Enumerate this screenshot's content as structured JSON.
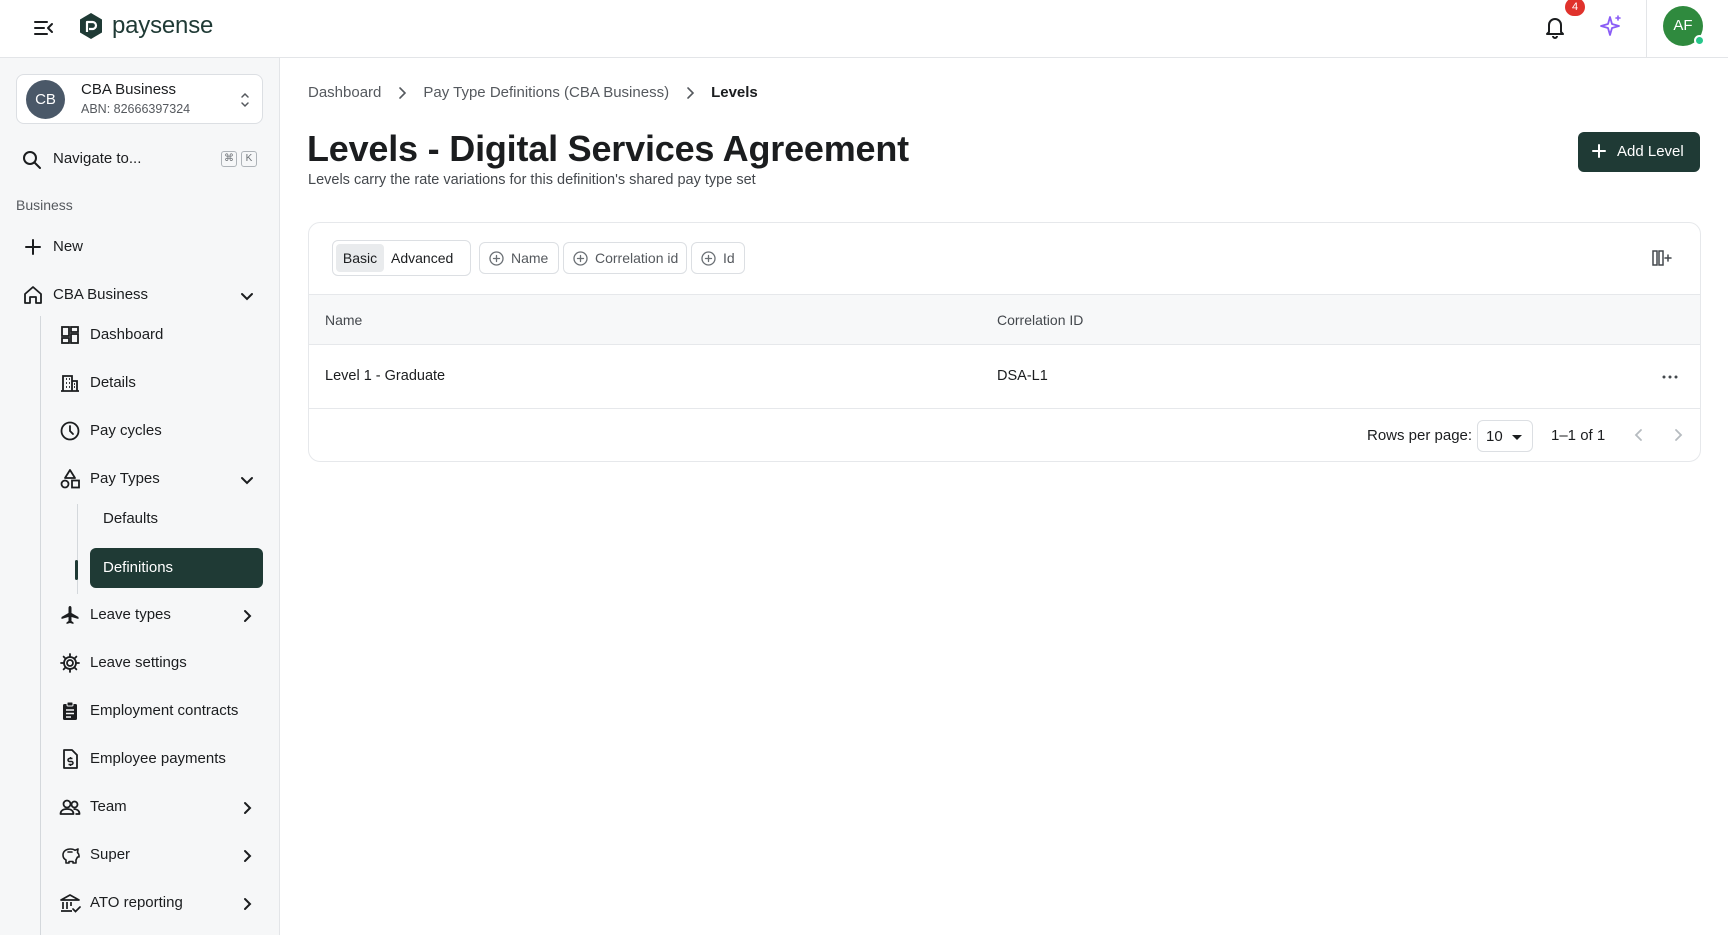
{
  "app": {
    "brand": "paysense",
    "notification_count": "4",
    "user_initials": "AF"
  },
  "sidebar": {
    "business": {
      "initials": "CB",
      "name": "CBA Business",
      "abn": "ABN: 82666397324"
    },
    "navigate": {
      "label": "Navigate to...",
      "shortcut_mod": "⌘",
      "shortcut_key": "K"
    },
    "section_label": "Business",
    "new_label": "New",
    "business_item": "CBA Business",
    "items": [
      {
        "label": "Dashboard",
        "icon": "dashboard-icon"
      },
      {
        "label": "Details",
        "icon": "building-icon"
      },
      {
        "label": "Pay cycles",
        "icon": "clock-icon"
      },
      {
        "label": "Pay Types",
        "icon": "shapes-icon"
      },
      {
        "label": "Defaults"
      },
      {
        "label": "Definitions"
      },
      {
        "label": "Leave types",
        "icon": "plane-icon"
      },
      {
        "label": "Leave settings",
        "icon": "gear-icon"
      },
      {
        "label": "Employment contracts",
        "icon": "clipboard-icon"
      },
      {
        "label": "Employee payments",
        "icon": "payment-doc-icon"
      },
      {
        "label": "Team",
        "icon": "people-icon"
      },
      {
        "label": "Super",
        "icon": "piggy-bank-icon"
      },
      {
        "label": "ATO reporting",
        "icon": "bank-icon"
      }
    ]
  },
  "breadcrumb": {
    "items": [
      "Dashboard",
      "Pay Type Definitions (CBA Business)"
    ],
    "current": "Levels"
  },
  "page": {
    "title": "Levels - Digital Services Agreement",
    "subtitle": "Levels carry the rate variations for this definition's shared pay type set",
    "add_button": "Add Level"
  },
  "filters": {
    "mode_basic": "Basic",
    "mode_advanced": "Advanced",
    "active_mode": "Basic",
    "chips": [
      "Name",
      "Correlation id",
      "Id"
    ]
  },
  "table": {
    "columns": [
      "Name",
      "Correlation ID"
    ],
    "rows": [
      {
        "name": "Level 1 - Graduate",
        "correlation_id": "DSA-L1"
      }
    ]
  },
  "pagination": {
    "rows_per_page_label": "Rows per page:",
    "rows_per_page": "10",
    "range": "1–1 of 1"
  },
  "colors": {
    "primary": "#1f3a35",
    "badge": "#e0322c",
    "avatar": "#2f8a3e",
    "sparkle": "#8a5cf6"
  }
}
